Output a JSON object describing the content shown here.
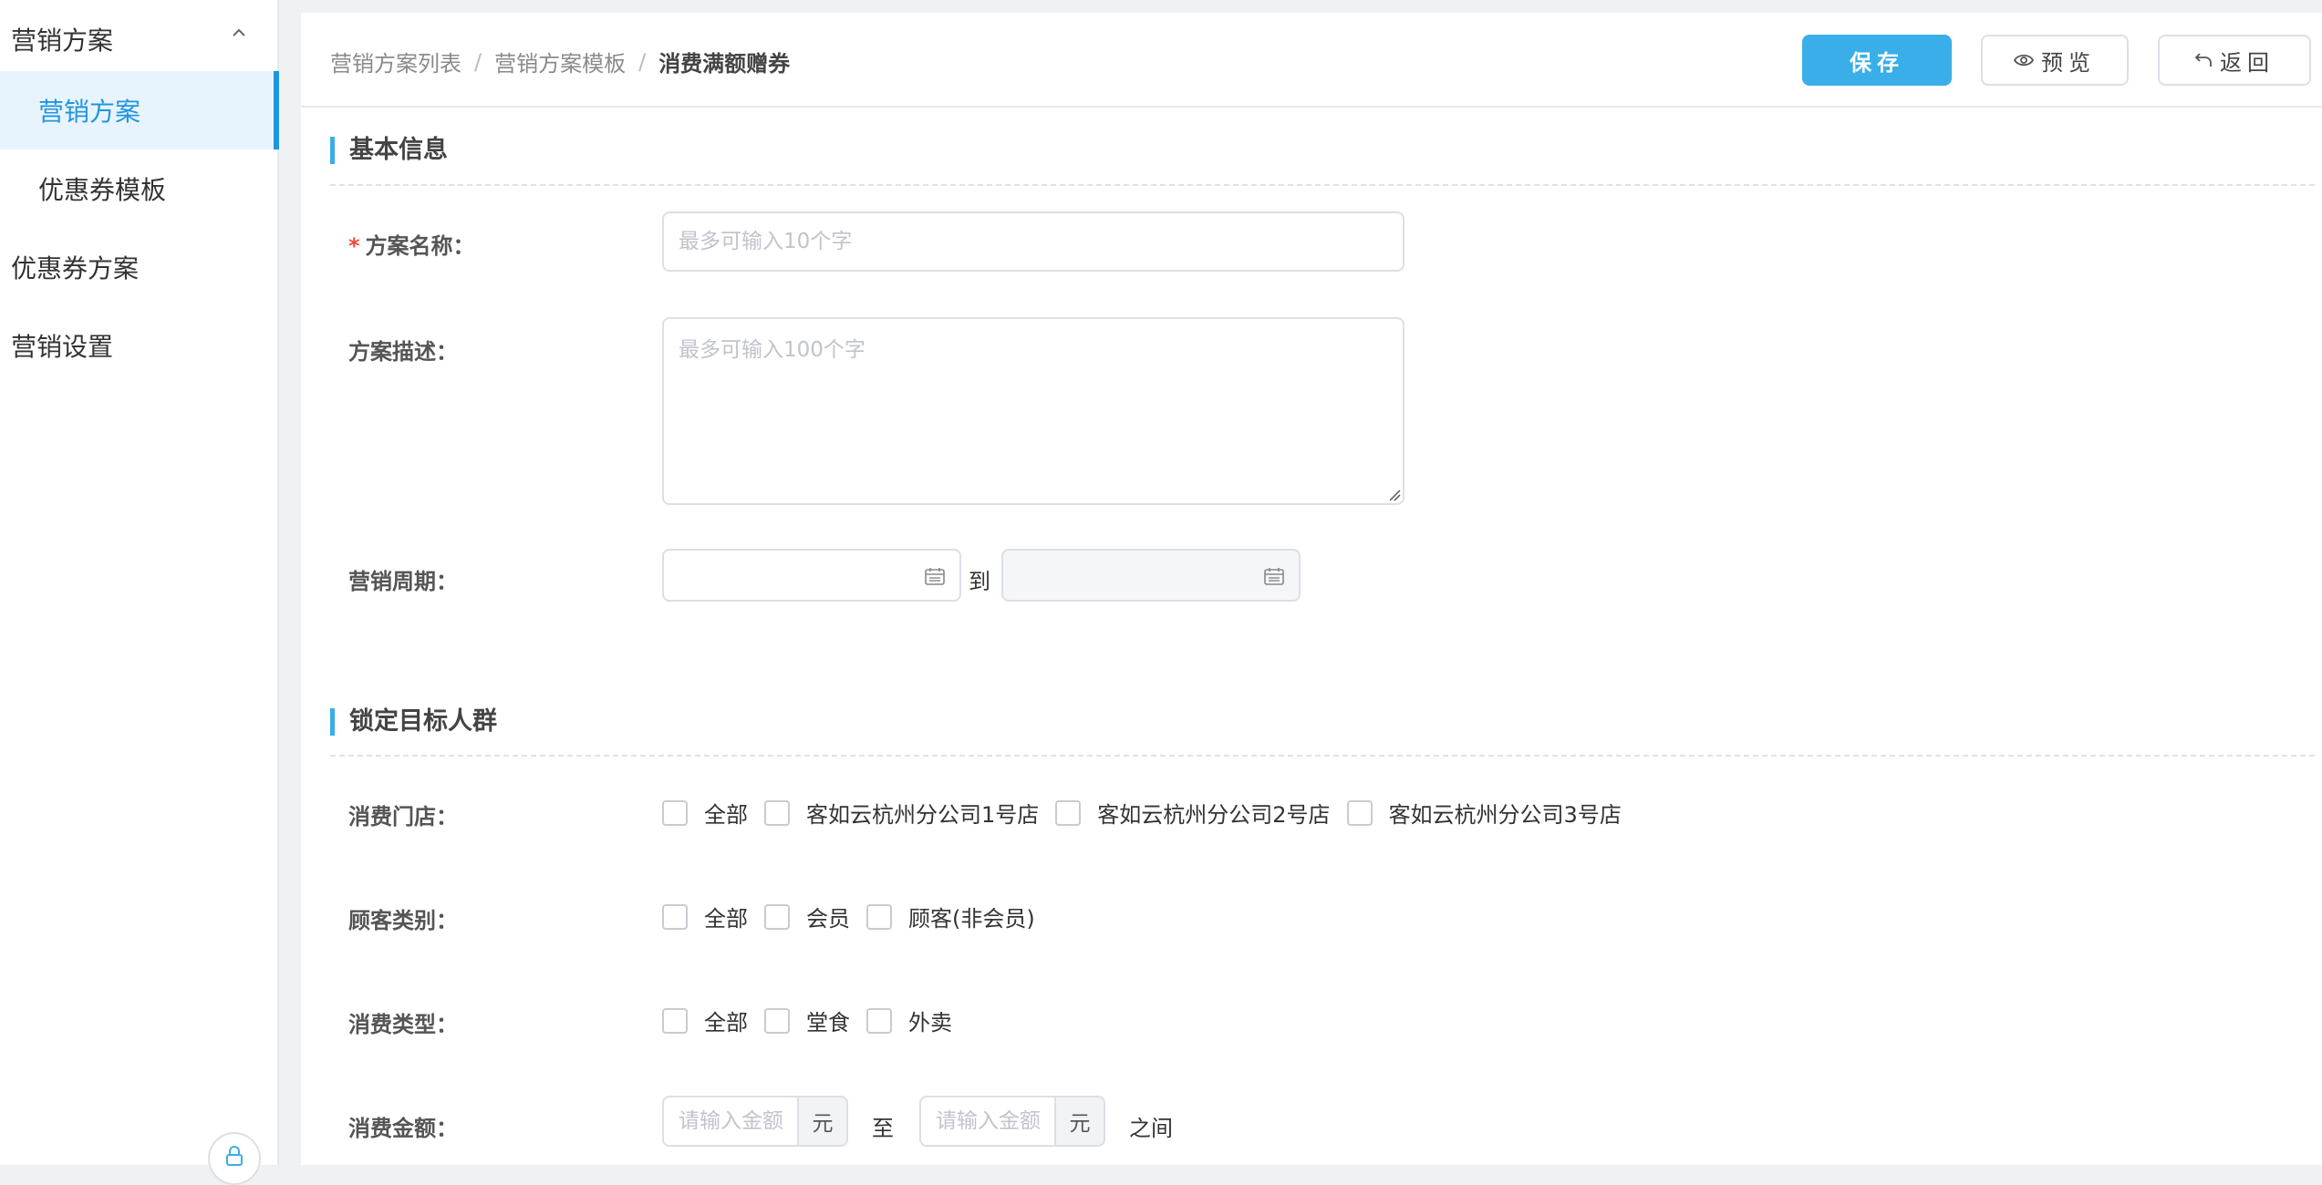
{
  "sidebar": {
    "items": [
      {
        "label": "营销方案"
      },
      {
        "label": "营销方案"
      },
      {
        "label": "优惠券模板"
      },
      {
        "label": "优惠券方案"
      },
      {
        "label": "营销设置"
      }
    ]
  },
  "breadcrumb": {
    "items": [
      "营销方案列表",
      "营销方案模板",
      "消费满额赠券"
    ],
    "separator": "/"
  },
  "toolbar": {
    "save_label": "保存",
    "preview_label": "预览",
    "back_label": "返回"
  },
  "basic_info": {
    "title": "基本信息",
    "name_label": "方案名称：",
    "name_required": "*",
    "name_placeholder": "最多可输入10个字",
    "desc_label": "方案描述：",
    "desc_placeholder": "最多可输入100个字",
    "period_label": "营销周期：",
    "period_to": "到"
  },
  "target": {
    "title": "锁定目标人群",
    "stores": {
      "label": "消费门店：",
      "options": [
        "全部",
        "客如云杭州分公司1号店",
        "客如云杭州分公司2号店",
        "客如云杭州分公司3号店"
      ]
    },
    "customer_type": {
      "label": "顾客类别：",
      "options": [
        "全部",
        "会员",
        "顾客(非会员)"
      ]
    },
    "consume_type": {
      "label": "消费类型：",
      "options": [
        "全部",
        "堂食",
        "外卖"
      ]
    },
    "amount": {
      "label": "消费金额：",
      "placeholder": "请输入金额",
      "unit": "元",
      "to": "至",
      "suffix": "之间"
    }
  },
  "colors": {
    "accent": "#3aaee8",
    "sidebar_active": "#1f95e0",
    "required": "#f5483b"
  }
}
